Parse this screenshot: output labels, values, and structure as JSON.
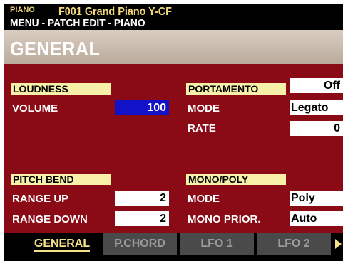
{
  "header": {
    "tone_type": "PIANO",
    "patch_name": "F001 Grand Piano Y-CF",
    "menu_path": "MENU - PATCH EDIT - PIANO"
  },
  "page_title": "GENERAL",
  "loudness": {
    "header": "LOUDNESS",
    "volume_label": "VOLUME",
    "volume_value": "100"
  },
  "portamento": {
    "header": "PORTAMENTO",
    "switch_value": "Off",
    "mode_label": "MODE",
    "mode_value": "Legato",
    "rate_label": "RATE",
    "rate_value": "0"
  },
  "pitch_bend": {
    "header": "PITCH BEND",
    "range_up_label": "RANGE UP",
    "range_up_value": "2",
    "range_down_label": "RANGE DOWN",
    "range_down_value": "2"
  },
  "mono_poly": {
    "header": "MONO/POLY",
    "mode_label": "MODE",
    "mode_value": "Poly",
    "priority_label": "MONO PRIOR.",
    "priority_value": "Auto"
  },
  "tabs": [
    {
      "label": "GENERAL",
      "active": true
    },
    {
      "label": "P.CHORD",
      "active": false
    },
    {
      "label": "LFO 1",
      "active": false
    },
    {
      "label": "LFO 2",
      "active": false
    }
  ],
  "icons": {
    "next_tab": "right-triangle-arrow-icon"
  },
  "colors": {
    "background": "#8a0a16",
    "section_header": "#f8f0a8",
    "selected_value": "#1212c8",
    "accent_text": "#f2d87a"
  }
}
